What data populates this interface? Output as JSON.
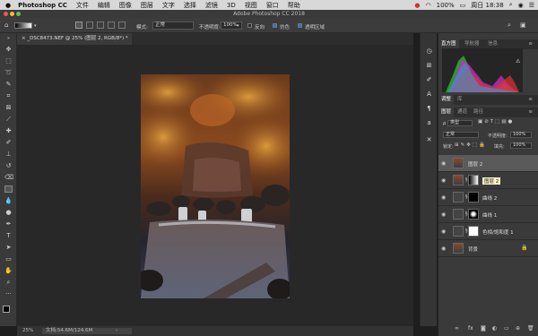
{
  "menubar": {
    "app_name": "Photoshop CC",
    "items": [
      "文件",
      "编辑",
      "图像",
      "图层",
      "文字",
      "选择",
      "滤镜",
      "3D",
      "视图",
      "窗口",
      "帮助"
    ],
    "battery": "100%",
    "clock": "周日 18:38"
  },
  "window": {
    "title": "Adobe Photoshop CC 2018"
  },
  "options": {
    "mode_label": "模式:",
    "mode_value": "正常",
    "opacity_label": "不透明度:",
    "opacity_value": "100%",
    "reverse": "反向",
    "dither": "仿色",
    "transparency": "透明区域"
  },
  "document": {
    "tab_title": "_DSC8473.NEF @ 25% (图层 2, RGB/8*) *"
  },
  "status": {
    "zoom": "25%",
    "doc_info": "文档:54.6M/124.6M"
  },
  "panels": {
    "top_tabs": [
      "直方图",
      "导航器",
      "信息"
    ],
    "mid_tabs": [
      "调整",
      "库"
    ],
    "layer_tabs": [
      "图层",
      "通道",
      "路径"
    ],
    "kind_label": "类型",
    "blend_mode": "正常",
    "opacity_label": "不透明度:",
    "opacity_value": "100%",
    "lock_label": "锁定:",
    "fill_label": "填充:",
    "fill_value": "100%",
    "tooltip": "图层 2"
  },
  "layers": [
    {
      "name": "图层 2"
    },
    {
      "name": "图层 1"
    },
    {
      "name": "曲线 2"
    },
    {
      "name": "曲线 1"
    },
    {
      "name": "色相/饱和度 1"
    },
    {
      "name": "背景"
    }
  ],
  "colors": {
    "accent": "#2f6fd6",
    "panel_bg": "#3a3a3a",
    "canvas_bg": "#282828"
  }
}
